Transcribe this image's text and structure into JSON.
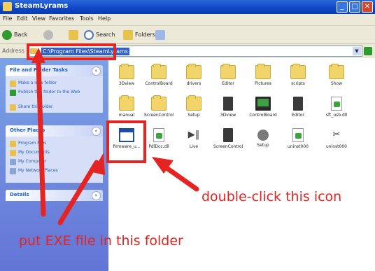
{
  "window": {
    "title": "SteamLyrams",
    "min": "_",
    "max": "□",
    "close": "✕"
  },
  "menu": [
    "File",
    "Edit",
    "View",
    "Favorites",
    "Tools",
    "Help"
  ],
  "toolbar": {
    "back": "Back",
    "search": "Search",
    "folders": "Folders"
  },
  "address": {
    "label": "Address",
    "path": "C:\\Program Files\\SteamLyrams",
    "go": "Go"
  },
  "sidebar": {
    "file_tasks": {
      "title": "File and Folder Tasks",
      "items": [
        "Make a new folder",
        "Publish this folder to the Web",
        "Share this folder"
      ]
    },
    "other_places": {
      "title": "Other Places",
      "items": [
        "Program Files",
        "My Documents",
        "My Computer",
        "My Network Places"
      ]
    },
    "details": {
      "title": "Details"
    }
  },
  "files": {
    "row1": [
      "3Dview",
      "ControlBoard",
      "drivers",
      "Editor",
      "Pictures",
      "scripts",
      "Show"
    ],
    "row2": [
      "manual",
      "ScreenControl",
      "Setup",
      "3Dview",
      "ControlBoard",
      "Editor",
      "sft_usb.dll"
    ],
    "row3": [
      "firmware_u...",
      "PdlDcc.dll",
      "Live",
      "ScreenControl",
      "Setup",
      "uninst000",
      "uninst000"
    ]
  },
  "icons": {
    "row1": [
      "folder-icon",
      "folder-icon",
      "folder-icon",
      "folder-icon",
      "folder-icon",
      "folder-icon",
      "folder-icon"
    ],
    "row2": [
      "folder-icon",
      "folder-icon",
      "folder-icon",
      "app-3dview-icon",
      "app-controlboard-icon",
      "app-editor-icon",
      "dll-file-icon"
    ],
    "row3": [
      "firmware-exe-icon",
      "dll-file-icon",
      "live-app-icon",
      "screencontrol-app-icon",
      "setup-gear-icon",
      "uninstall-doc-icon",
      "uninstall-icon"
    ]
  },
  "annotations": {
    "double_click": "double-click this icon",
    "put_exe": "put EXE file in this folder"
  },
  "colors": {
    "annotation": "#e52421",
    "titlebar": "#0f46c4",
    "sidebar": "#6f8fe0"
  }
}
